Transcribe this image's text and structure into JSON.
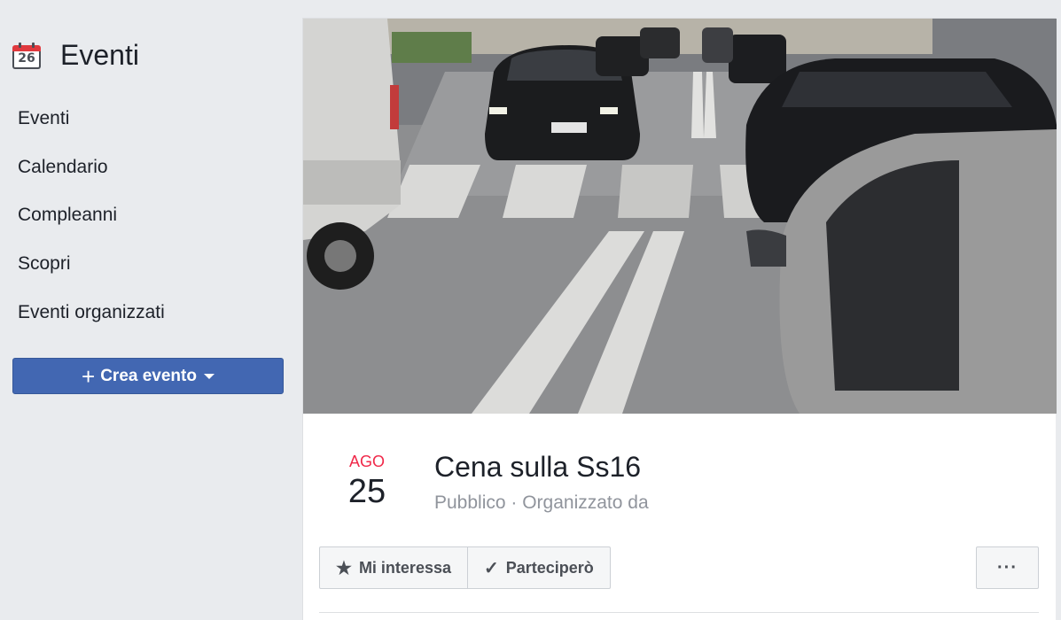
{
  "sidebar": {
    "title": "Eventi",
    "calendar_icon": {
      "name": "calendar-icon",
      "day": "26",
      "color": "#e0393e"
    },
    "items": [
      {
        "label": "Eventi"
      },
      {
        "label": "Calendario"
      },
      {
        "label": "Compleanni"
      },
      {
        "label": "Scopri"
      },
      {
        "label": "Eventi organizzati"
      }
    ],
    "create_button": {
      "label": "Crea evento",
      "icon": "plus-icon",
      "color": "#4267b2"
    }
  },
  "event": {
    "month": "AGO",
    "day": "25",
    "title": "Cena sulla Ss16",
    "meta": "Pubblico · Organizzato da",
    "cover_image": "street-with-parked-cars-photo",
    "actions": [
      {
        "label": "Mi interessa",
        "icon": "star-icon"
      },
      {
        "label": "Parteciperò",
        "icon": "checkmark-icon"
      }
    ],
    "more_label": "···"
  },
  "colors": {
    "background": "#e9ebee",
    "accent": "#4267b2",
    "date_month": "#f02849"
  }
}
